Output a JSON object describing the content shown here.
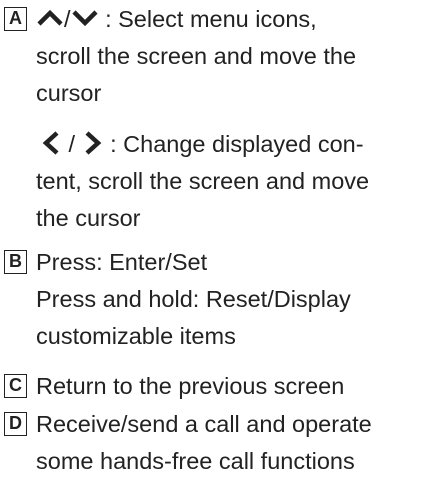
{
  "items": {
    "a": {
      "badge": "A",
      "sep": "/",
      "line1_rest": ": Select menu icons,",
      "line2": "scroll the screen and move the",
      "line3": "cursor",
      "sub": {
        "sep": "/",
        "line1_rest": ": Change displayed con-",
        "line2": "tent, scroll the screen and move",
        "line3": "the cursor"
      },
      "icons": [
        "chevron-up-icon",
        "chevron-down-icon",
        "chevron-left-icon",
        "chevron-right-icon"
      ]
    },
    "b": {
      "badge": "B",
      "line1": "Press: Enter/Set",
      "line2": "Press and hold: Reset/Display",
      "line3": "customizable items"
    },
    "c": {
      "badge": "C",
      "line1": "Return to the previous screen"
    },
    "d": {
      "badge": "D",
      "line1": "Receive/send a call and operate",
      "line2": "some hands-free call functions"
    }
  }
}
